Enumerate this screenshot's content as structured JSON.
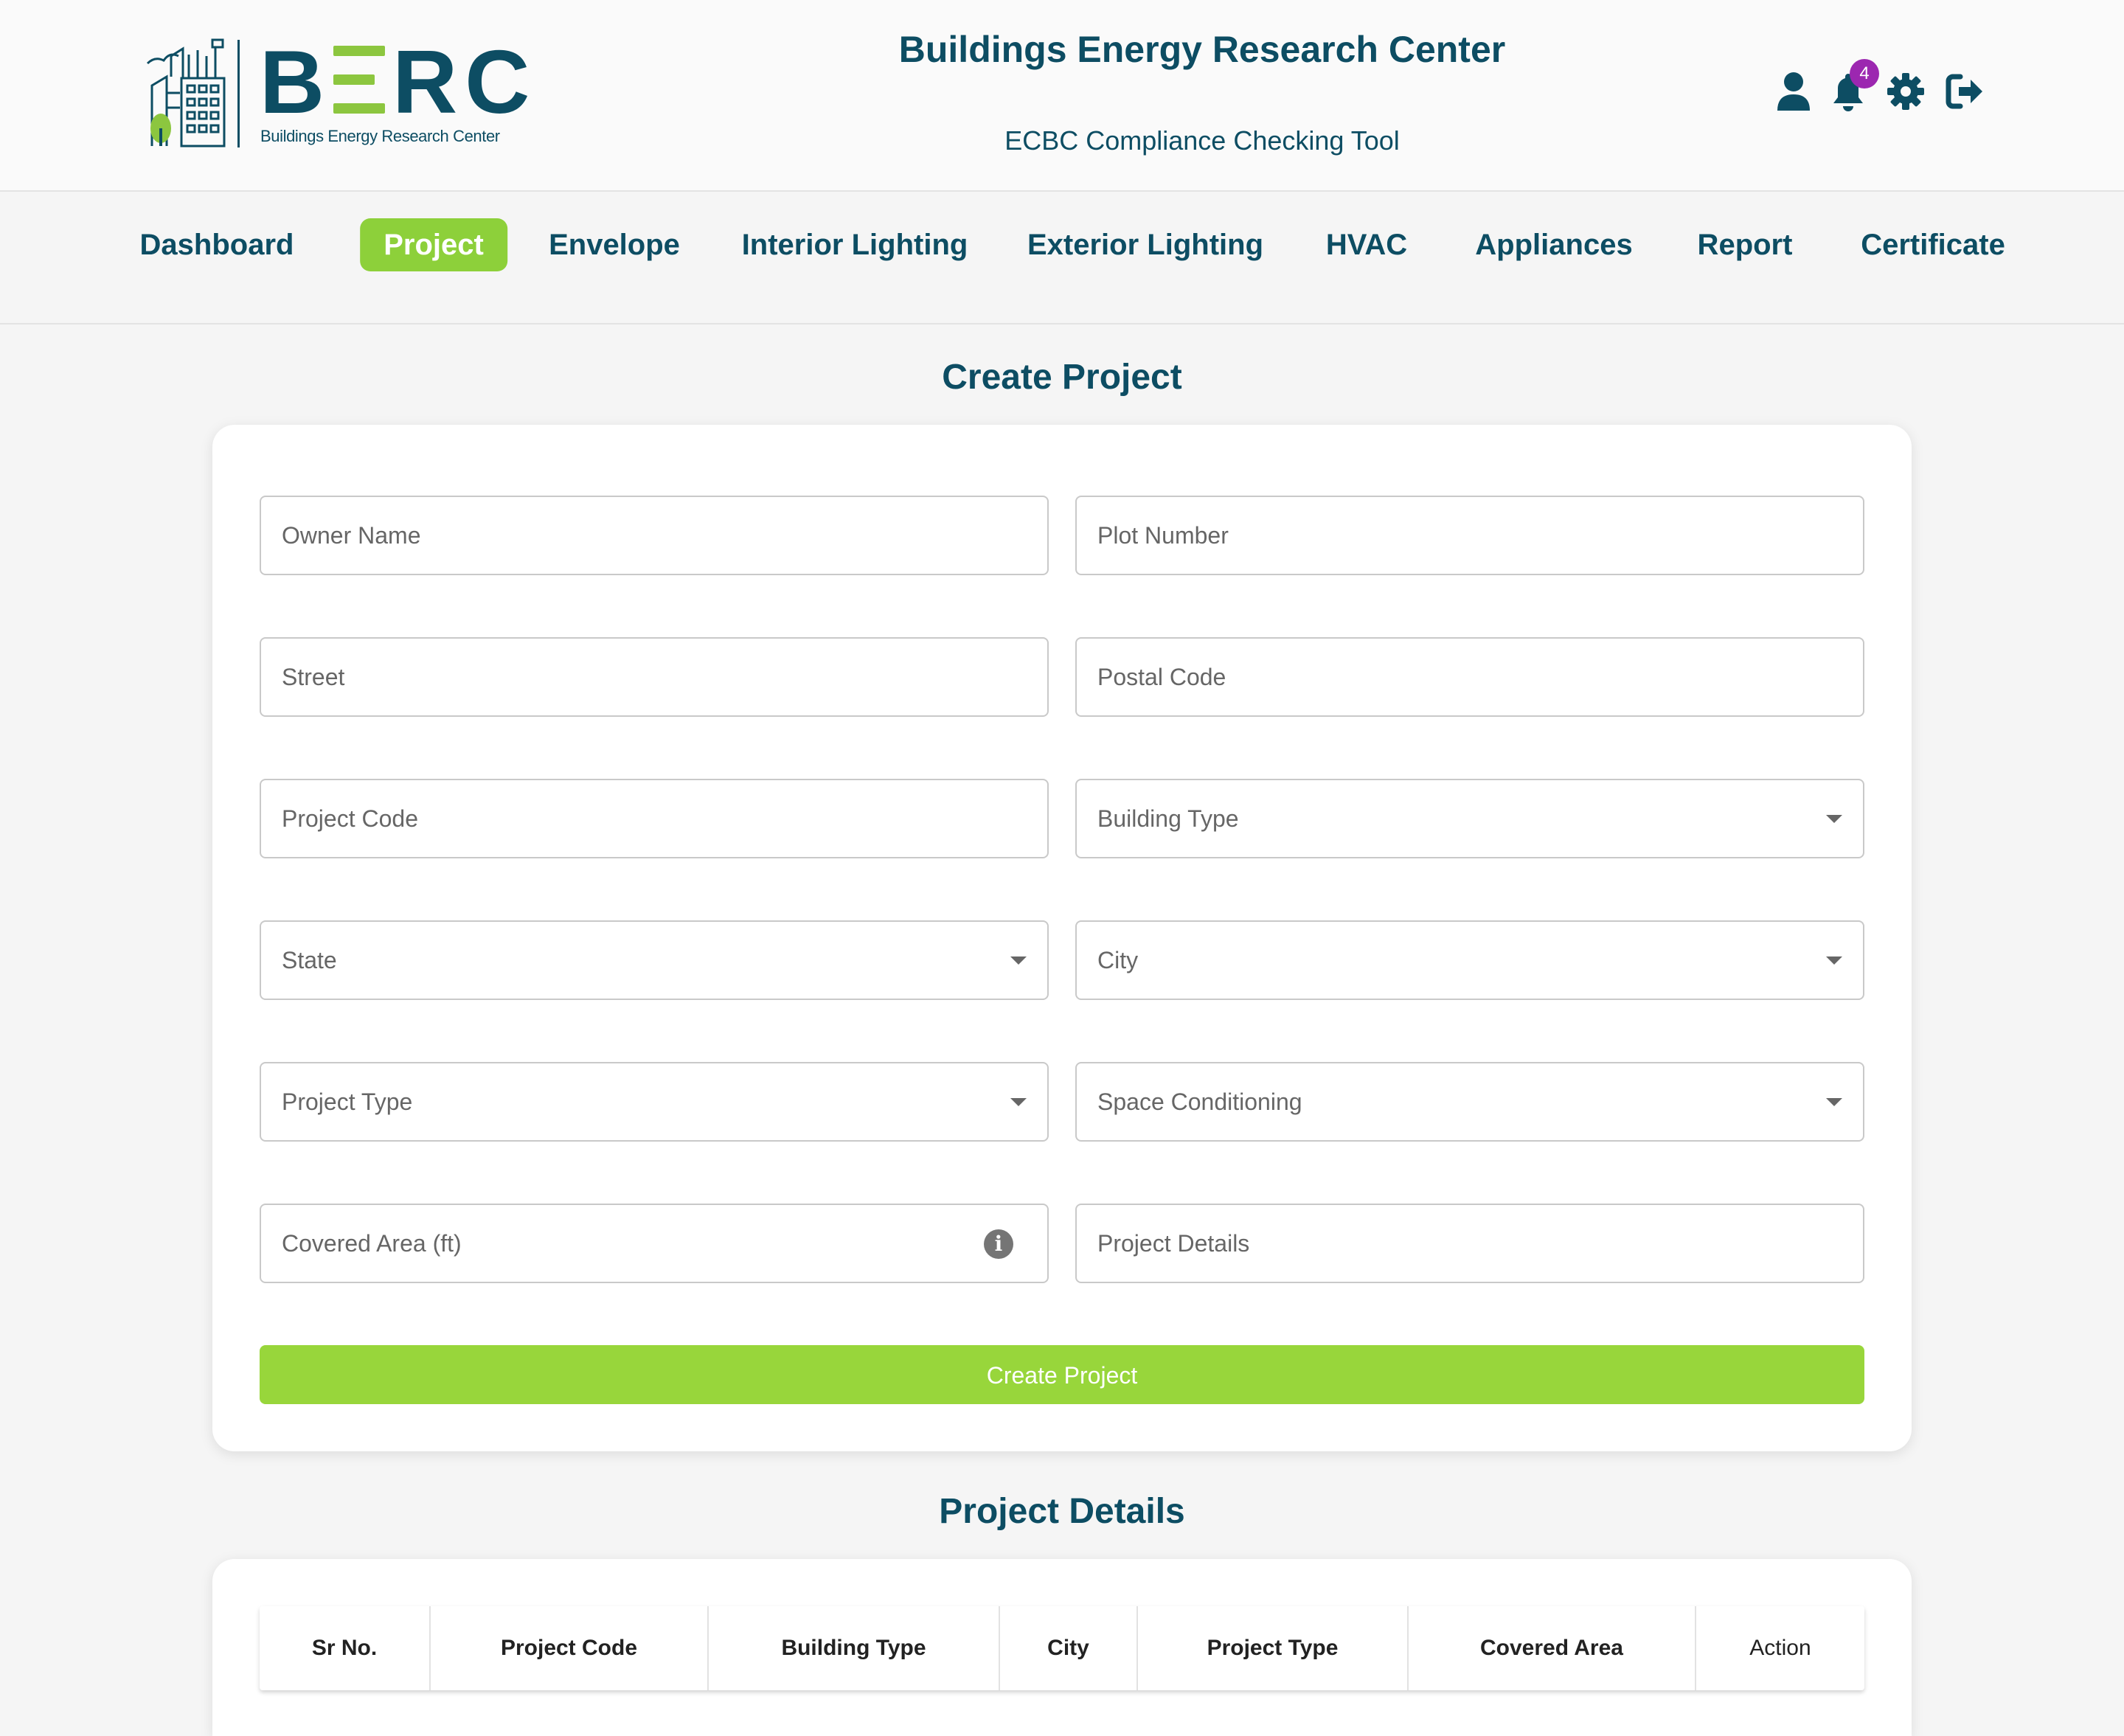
{
  "header": {
    "logo_text": "B",
    "logo_text_2": "RC",
    "logo_subtitle": "Buildings Energy Research Center",
    "title": "Buildings Energy Research Center",
    "subtitle": "ECBC Compliance Checking Tool",
    "notification_count": "4",
    "icons": [
      "user-icon",
      "bell-icon",
      "gear-icon",
      "logout-icon"
    ]
  },
  "nav": {
    "items": [
      {
        "label": "Dashboard"
      },
      {
        "label": "Project"
      },
      {
        "label": "Envelope"
      },
      {
        "label": "Interior Lighting"
      },
      {
        "label": "Exterior Lighting"
      },
      {
        "label": "HVAC"
      },
      {
        "label": "Appliances"
      },
      {
        "label": "Report"
      },
      {
        "label": "Certificate"
      }
    ],
    "active": "Project"
  },
  "form": {
    "title": "Create Project",
    "fields": {
      "owner_name": {
        "placeholder": "Owner Name"
      },
      "plot_number": {
        "placeholder": "Plot Number"
      },
      "street": {
        "placeholder": "Street"
      },
      "postal_code": {
        "placeholder": "Postal Code"
      },
      "project_code": {
        "placeholder": "Project Code"
      },
      "building_type": {
        "placeholder": "Building Type"
      },
      "state": {
        "placeholder": "State"
      },
      "city": {
        "placeholder": "City"
      },
      "project_type": {
        "placeholder": "Project Type"
      },
      "space_conditioning": {
        "placeholder": "Space Conditioning"
      },
      "covered_area": {
        "placeholder": "Covered Area (ft)"
      },
      "project_details": {
        "placeholder": "Project Details"
      }
    },
    "submit_label": "Create Project"
  },
  "table": {
    "title": "Project Details",
    "columns": [
      "Sr No.",
      "Project Code",
      "Building Type",
      "City",
      "Project Type",
      "Covered Area",
      "Action"
    ]
  },
  "colors": {
    "primary": "#0d4d63",
    "accent": "#8dd03a",
    "badge": "#9c27b0"
  }
}
